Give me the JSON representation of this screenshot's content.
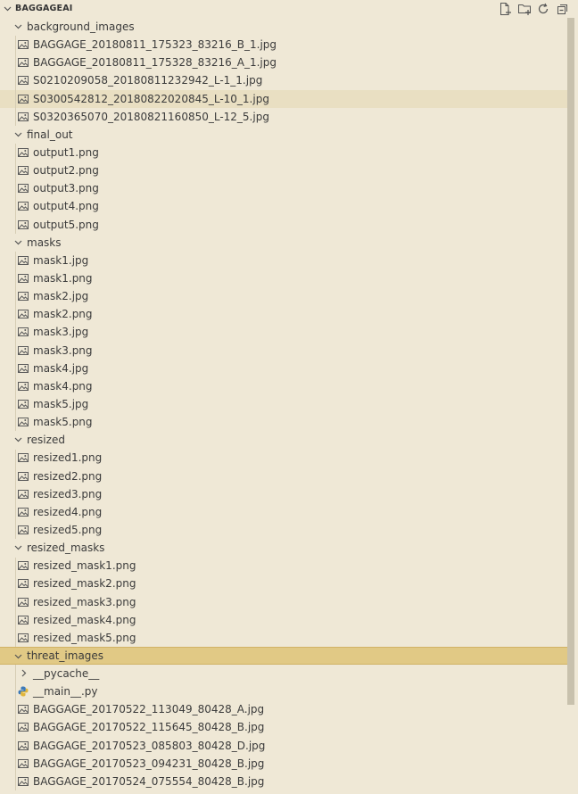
{
  "explorer": {
    "title": "BAGGAGEAI"
  },
  "toolbar": {
    "icons": [
      "new-file-icon",
      "new-folder-icon",
      "refresh-icon",
      "collapse-all-icon"
    ]
  },
  "tree": [
    {
      "type": "folder",
      "name": "background_images",
      "expanded": true,
      "children": [
        {
          "type": "image",
          "name": "BAGGAGE_20180811_175323_83216_B_1.jpg"
        },
        {
          "type": "image",
          "name": "BAGGAGE_20180811_175328_83216_A_1.jpg"
        },
        {
          "type": "image",
          "name": "S0210209058_20180811232942_L-1_1.jpg"
        },
        {
          "type": "image",
          "name": "S0300542812_20180822020845_L-10_1.jpg",
          "state": "hover"
        },
        {
          "type": "image",
          "name": "S0320365070_20180821160850_L-12_5.jpg"
        }
      ]
    },
    {
      "type": "folder",
      "name": "final_out",
      "expanded": true,
      "children": [
        {
          "type": "image",
          "name": "output1.png"
        },
        {
          "type": "image",
          "name": "output2.png"
        },
        {
          "type": "image",
          "name": "output3.png"
        },
        {
          "type": "image",
          "name": "output4.png"
        },
        {
          "type": "image",
          "name": "output5.png"
        }
      ]
    },
    {
      "type": "folder",
      "name": "masks",
      "expanded": true,
      "children": [
        {
          "type": "image",
          "name": "mask1.jpg"
        },
        {
          "type": "image",
          "name": "mask1.png"
        },
        {
          "type": "image",
          "name": "mask2.jpg"
        },
        {
          "type": "image",
          "name": "mask2.png"
        },
        {
          "type": "image",
          "name": "mask3.jpg"
        },
        {
          "type": "image",
          "name": "mask3.png"
        },
        {
          "type": "image",
          "name": "mask4.jpg"
        },
        {
          "type": "image",
          "name": "mask4.png"
        },
        {
          "type": "image",
          "name": "mask5.jpg"
        },
        {
          "type": "image",
          "name": "mask5.png"
        }
      ]
    },
    {
      "type": "folder",
      "name": "resized",
      "expanded": true,
      "children": [
        {
          "type": "image",
          "name": "resized1.png"
        },
        {
          "type": "image",
          "name": "resized2.png"
        },
        {
          "type": "image",
          "name": "resized3.png"
        },
        {
          "type": "image",
          "name": "resized4.png"
        },
        {
          "type": "image",
          "name": "resized5.png"
        }
      ]
    },
    {
      "type": "folder",
      "name": "resized_masks",
      "expanded": true,
      "children": [
        {
          "type": "image",
          "name": "resized_mask1.png"
        },
        {
          "type": "image",
          "name": "resized_mask2.png"
        },
        {
          "type": "image",
          "name": "resized_mask3.png"
        },
        {
          "type": "image",
          "name": "resized_mask4.png"
        },
        {
          "type": "image",
          "name": "resized_mask5.png"
        }
      ]
    },
    {
      "type": "folder",
      "name": "threat_images",
      "expanded": true,
      "state": "selected",
      "children": [
        {
          "type": "folder",
          "name": "__pycache__",
          "expanded": false,
          "children": []
        },
        {
          "type": "python",
          "name": "__main__.py"
        },
        {
          "type": "image",
          "name": "BAGGAGE_20170522_113049_80428_A.jpg"
        },
        {
          "type": "image",
          "name": "BAGGAGE_20170522_115645_80428_B.jpg"
        },
        {
          "type": "image",
          "name": "BAGGAGE_20170523_085803_80428_D.jpg"
        },
        {
          "type": "image",
          "name": "BAGGAGE_20170523_094231_80428_B.jpg"
        },
        {
          "type": "image",
          "name": "BAGGAGE_20170524_075554_80428_B.jpg"
        }
      ]
    }
  ],
  "colors": {
    "background": "#efe8d6",
    "hover": "#e9dfc2",
    "selected": "#e1c985",
    "icon": "#5b5b5b",
    "python_icon": "#3d7ab8"
  }
}
